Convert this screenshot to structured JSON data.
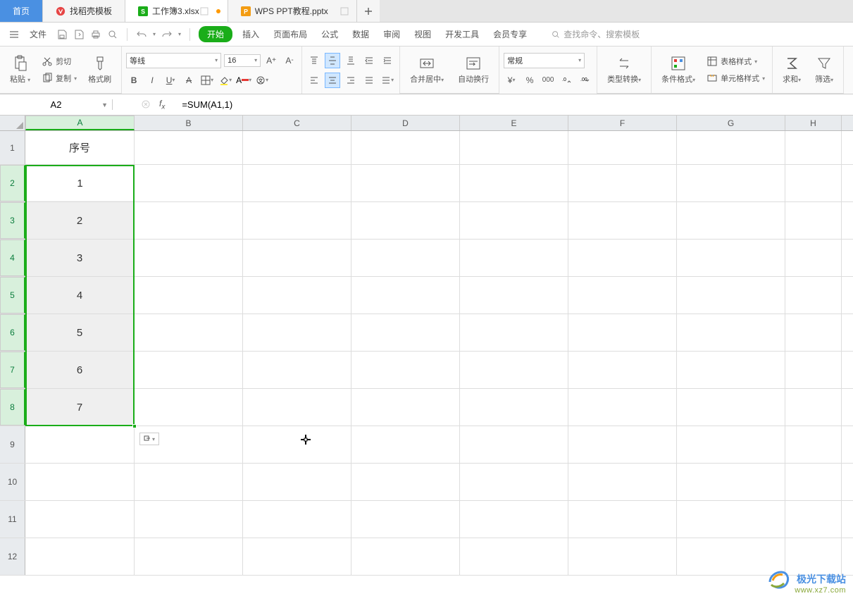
{
  "tabs": {
    "home": "首页",
    "t1": "找稻壳模板",
    "t2": "工作簿3.xlsx",
    "t3": "WPS PPT教程.pptx"
  },
  "menu": {
    "file": "文件",
    "items": [
      "开始",
      "插入",
      "页面布局",
      "公式",
      "数据",
      "审阅",
      "视图",
      "开发工具",
      "会员专享"
    ],
    "search_placeholder": "查找命令、搜索模板",
    "search_icon": "查找"
  },
  "ribbon": {
    "paste": "粘贴",
    "cut": "剪切",
    "copy": "复制",
    "format_painter": "格式刷",
    "font_name": "等线",
    "font_size": "16",
    "merge": "合并居中",
    "wrap": "自动换行",
    "number_format": "常规",
    "type_convert": "类型转换",
    "cond_fmt": "条件格式",
    "table_style": "表格样式",
    "cell_style": "单元格样式",
    "sum": "求和",
    "filter": "筛选"
  },
  "formula_bar": {
    "name": "A2",
    "formula": "=SUM(A1,1)"
  },
  "columns": [
    "A",
    "B",
    "C",
    "D",
    "E",
    "F",
    "G",
    "H"
  ],
  "col_a_width": 155,
  "other_col_width": 154,
  "row_heights": {
    "header": 48,
    "data": 53,
    "rest": 53
  },
  "rows": [
    {
      "n": "1",
      "a": "序号",
      "sel": false,
      "head": true
    },
    {
      "n": "2",
      "a": "1",
      "sel": true
    },
    {
      "n": "3",
      "a": "2",
      "sel": true
    },
    {
      "n": "4",
      "a": "3",
      "sel": true
    },
    {
      "n": "5",
      "a": "4",
      "sel": true
    },
    {
      "n": "6",
      "a": "5",
      "sel": true
    },
    {
      "n": "7",
      "a": "6",
      "sel": true
    },
    {
      "n": "8",
      "a": "7",
      "sel": true
    },
    {
      "n": "9",
      "a": "",
      "sel": false
    },
    {
      "n": "10",
      "a": "",
      "sel": false
    },
    {
      "n": "11",
      "a": "",
      "sel": false
    },
    {
      "n": "12",
      "a": "",
      "sel": false
    }
  ],
  "watermark": {
    "brand": "极光下载站",
    "url": "www.xz7.com"
  },
  "chart_data": {
    "type": "table",
    "title": "序号",
    "categories": [
      "序号"
    ],
    "values": [
      1,
      2,
      3,
      4,
      5,
      6,
      7
    ]
  }
}
